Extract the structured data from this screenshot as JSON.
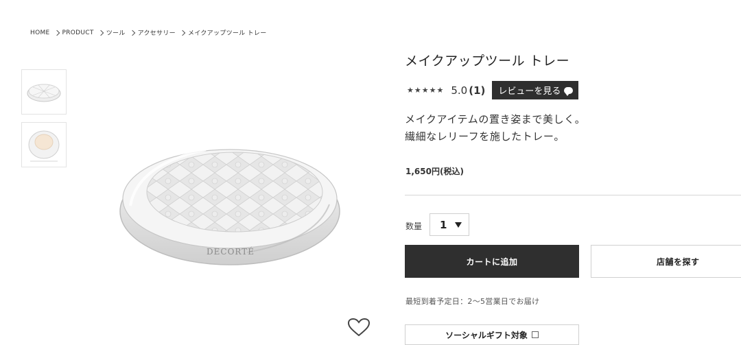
{
  "breadcrumb": [
    "HOME",
    "PRODUCT",
    "ツール",
    "アクセサリー",
    "メイクアップツール トレー"
  ],
  "product": {
    "brand_mark": "DECORTÉ",
    "title": "メイクアップツール トレー",
    "rating": {
      "stars": 5,
      "score": "5.0",
      "count": "(1)",
      "review_button": "レビューを見る"
    },
    "description": [
      "メイクアイテムの置き姿まで美しく。",
      "繊細なレリーフを施したトレー。"
    ],
    "price": "1,650円(税込)"
  },
  "quantity": {
    "label": "数量",
    "value": "1"
  },
  "buttons": {
    "add_to_cart": "カートに追加",
    "find_store": "店舗を探す"
  },
  "delivery_note": "最短到着予定日：2〜5営業日でお届け",
  "social_gift": "ソーシャルギフト対象",
  "colors": {
    "dark_button": "#2f2f2f",
    "border": "#cfcfcf"
  }
}
